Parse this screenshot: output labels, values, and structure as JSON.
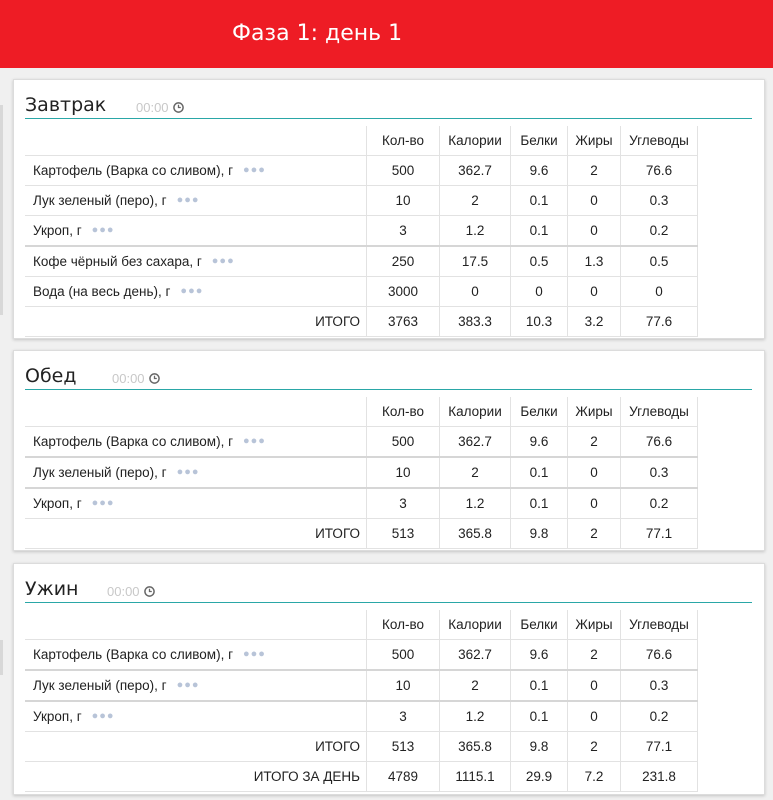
{
  "page": {
    "title": "Фаза 1: день 1"
  },
  "columns": [
    "Кол-во",
    "Калории",
    "Белки",
    "Жиры",
    "Углеводы"
  ],
  "meals": [
    {
      "title": "Завтрак",
      "time": "00:00",
      "items": [
        {
          "name": "Картофель (Варка со сливом), г",
          "qty": "500",
          "cal": "362.7",
          "prot": "9.6",
          "fat": "2",
          "carb": "76.6"
        },
        {
          "name": "Лук зеленый (перо), г",
          "qty": "10",
          "cal": "2",
          "prot": "0.1",
          "fat": "0",
          "carb": "0.3"
        },
        {
          "name": "Укроп, г",
          "qty": "3",
          "cal": "1.2",
          "prot": "0.1",
          "fat": "0",
          "carb": "0.2"
        },
        {
          "name": "Кофе чёрный без сахара, г",
          "qty": "250",
          "cal": "17.5",
          "prot": "0.5",
          "fat": "1.3",
          "carb": "0.5"
        },
        {
          "name": "Вода (на весь день), г",
          "qty": "3000",
          "cal": "0",
          "prot": "0",
          "fat": "0",
          "carb": "0"
        }
      ],
      "total": {
        "label": "ИТОГО",
        "qty": "3763",
        "cal": "383.3",
        "prot": "10.3",
        "fat": "3.2",
        "carb": "77.6"
      }
    },
    {
      "title": "Обед",
      "time": "00:00",
      "items": [
        {
          "name": "Картофель (Варка со сливом), г",
          "qty": "500",
          "cal": "362.7",
          "prot": "9.6",
          "fat": "2",
          "carb": "76.6"
        },
        {
          "name": "Лук зеленый (перо), г",
          "qty": "10",
          "cal": "2",
          "prot": "0.1",
          "fat": "0",
          "carb": "0.3"
        },
        {
          "name": "Укроп, г",
          "qty": "3",
          "cal": "1.2",
          "prot": "0.1",
          "fat": "0",
          "carb": "0.2"
        }
      ],
      "total": {
        "label": "ИТОГО",
        "qty": "513",
        "cal": "365.8",
        "prot": "9.8",
        "fat": "2",
        "carb": "77.1"
      }
    },
    {
      "title": "Ужин",
      "time": "00:00",
      "items": [
        {
          "name": "Картофель (Варка со сливом), г",
          "qty": "500",
          "cal": "362.7",
          "prot": "9.6",
          "fat": "2",
          "carb": "76.6"
        },
        {
          "name": "Лук зеленый (перо), г",
          "qty": "10",
          "cal": "2",
          "prot": "0.1",
          "fat": "0",
          "carb": "0.3"
        },
        {
          "name": "Укроп, г",
          "qty": "3",
          "cal": "1.2",
          "prot": "0.1",
          "fat": "0",
          "carb": "0.2"
        }
      ],
      "total": {
        "label": "ИТОГО",
        "qty": "513",
        "cal": "365.8",
        "prot": "9.8",
        "fat": "2",
        "carb": "77.1"
      },
      "day_total": {
        "label": "ИТОГО ЗА ДЕНЬ",
        "qty": "4789",
        "cal": "1115.1",
        "prot": "29.9",
        "fat": "7.2",
        "carb": "231.8"
      }
    }
  ],
  "icons": {
    "clock": "clock-icon",
    "more": "more-dots-icon"
  },
  "colors": {
    "header": "#ee1c25",
    "accent_line": "#2aa7a7",
    "muted": "#c8c8c8"
  }
}
